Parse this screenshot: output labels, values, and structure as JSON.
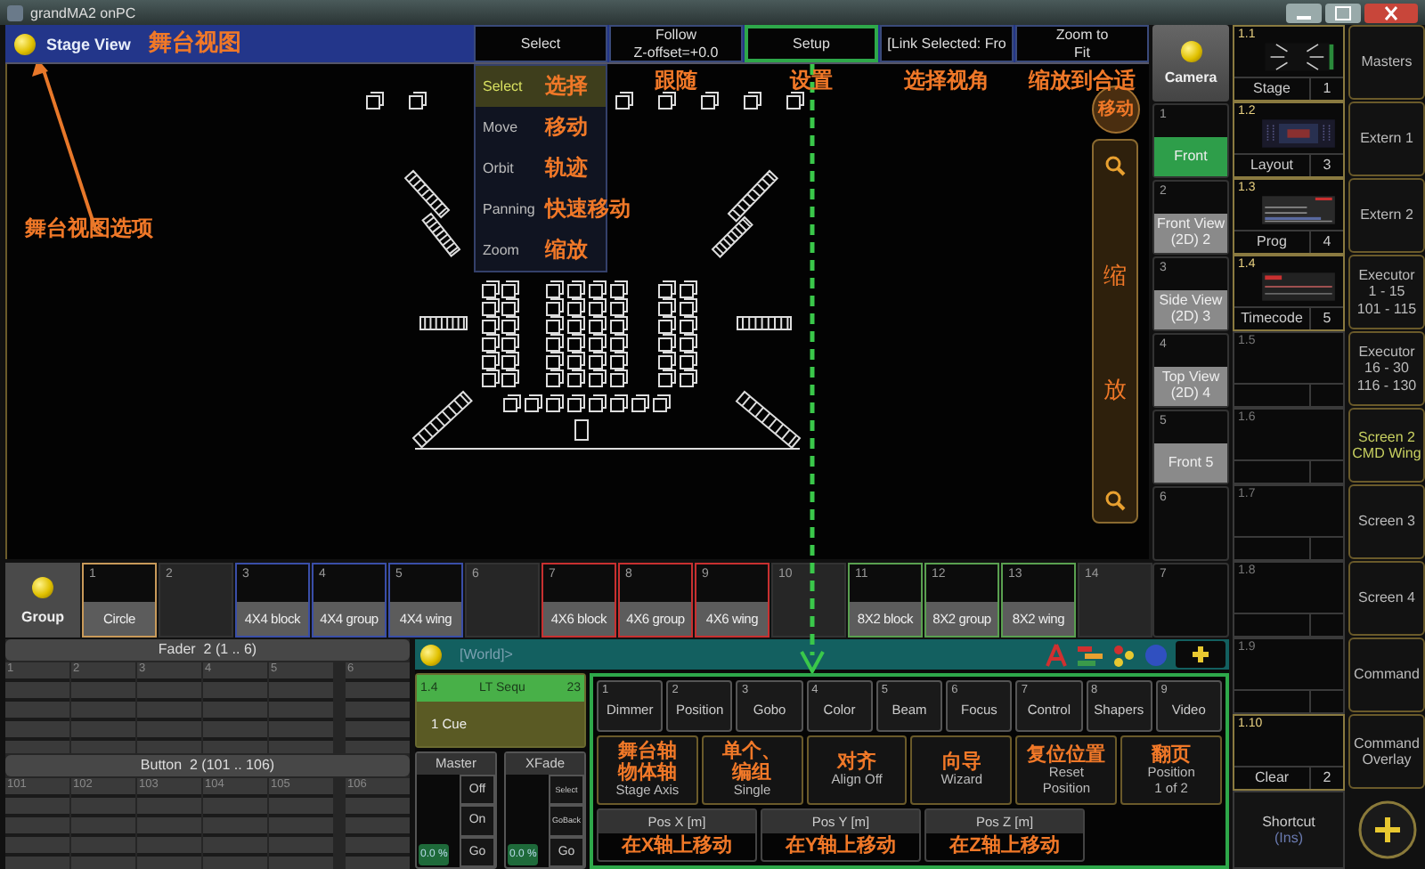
{
  "window": {
    "title": "grandMA2 onPC"
  },
  "stage_view": {
    "title": "Stage View",
    "title_note": "舞台视图",
    "options_note": "舞台视图选项",
    "toolbar": [
      {
        "lines": [
          "Select"
        ],
        "highlighted": false
      },
      {
        "lines": [
          "Follow",
          "Z-offset=+0.0"
        ],
        "highlighted": false,
        "note": "跟随"
      },
      {
        "lines": [
          "Setup"
        ],
        "highlighted": true,
        "note": "设置"
      },
      {
        "lines": [
          "[Link Selected: Fro"
        ],
        "highlighted": false,
        "note": "选择视角"
      },
      {
        "lines": [
          "Zoom to",
          "Fit"
        ],
        "highlighted": false,
        "note": "缩放到合适"
      }
    ],
    "menu": [
      {
        "label": "Select",
        "selected": true,
        "note": "选择"
      },
      {
        "label": "Move",
        "selected": false,
        "note": "移动"
      },
      {
        "label": "Orbit",
        "selected": false,
        "note": "轨迹"
      },
      {
        "label": "Panning",
        "selected": false,
        "note": "快速移动"
      },
      {
        "label": "Zoom",
        "selected": false,
        "note": "缩放"
      }
    ],
    "move_note": "移动",
    "zoom_notes": [
      "缩",
      "放"
    ]
  },
  "camera": {
    "title": "Camera",
    "views": [
      {
        "number": "1",
        "label": "Front",
        "selected": true
      },
      {
        "number": "2",
        "label": "Front View (2D) 2",
        "selected": false
      },
      {
        "number": "3",
        "label": "Side View (2D) 3",
        "selected": false
      },
      {
        "number": "4",
        "label": "Top View (2D) 4",
        "selected": false
      },
      {
        "number": "5",
        "label": "Front 5",
        "selected": false
      },
      {
        "number": "6"
      },
      {
        "number": "7"
      }
    ]
  },
  "views": [
    {
      "number": "1.1",
      "label": "Stage",
      "count": "1",
      "kind": "stage"
    },
    {
      "number": "1.2",
      "label": "Layout",
      "count": "3",
      "kind": "layout"
    },
    {
      "number": "1.3",
      "label": "Prog",
      "count": "4",
      "kind": "prog"
    },
    {
      "number": "1.4",
      "label": "Timecode",
      "count": "5",
      "kind": "timecode"
    },
    {
      "number": "1.5",
      "kind": "empty"
    },
    {
      "number": "1.6",
      "kind": "empty"
    },
    {
      "number": "1.7",
      "kind": "empty"
    },
    {
      "number": "1.8",
      "kind": "empty"
    },
    {
      "number": "1.9",
      "kind": "empty"
    },
    {
      "number": "1.10",
      "label": "Clear",
      "count": "2",
      "kind": "empty"
    },
    {
      "label": "Shortcut",
      "sub": "(Ins)",
      "kind": "shortcut"
    }
  ],
  "screens": [
    {
      "lines": [
        "Masters"
      ],
      "active": false
    },
    {
      "lines": [
        "Extern 1"
      ],
      "active": false
    },
    {
      "lines": [
        "Extern 2"
      ],
      "active": false
    },
    {
      "lines": [
        "Executor",
        "1 - 15",
        "101 - 115"
      ],
      "active": false
    },
    {
      "lines": [
        "Executor",
        "16 - 30",
        "116 - 130"
      ],
      "active": false
    },
    {
      "lines": [
        "Screen 2",
        "CMD Wing"
      ],
      "active": true
    },
    {
      "lines": [
        "Screen 3"
      ],
      "active": false
    },
    {
      "lines": [
        "Screen 4"
      ],
      "active": false
    },
    {
      "lines": [
        "Command"
      ],
      "active": false
    },
    {
      "lines": [
        "Command",
        "Overlay"
      ],
      "active": false
    }
  ],
  "groups": {
    "title": "Group",
    "items": [
      {
        "number": "1",
        "label": "Circle",
        "color": "#c89a5a"
      },
      {
        "number": "2"
      },
      {
        "number": "3",
        "label": "4X4 block",
        "color": "#3a4ea8"
      },
      {
        "number": "4",
        "label": "4X4 group",
        "color": "#3a4ea8"
      },
      {
        "number": "5",
        "label": "4X4 wing",
        "color": "#3a4ea8"
      },
      {
        "number": "6"
      },
      {
        "number": "7",
        "label": "4X6 block",
        "color": "#c83030"
      },
      {
        "number": "8",
        "label": "4X6 group",
        "color": "#c83030"
      },
      {
        "number": "9",
        "label": "4X6 wing",
        "color": "#c83030"
      },
      {
        "number": "10"
      },
      {
        "number": "11",
        "label": "8X2 block",
        "color": "#5aa050"
      },
      {
        "number": "12",
        "label": "8X2 group",
        "color": "#5aa050"
      },
      {
        "number": "13",
        "label": "8X2 wing",
        "color": "#5aa050"
      },
      {
        "number": "14"
      }
    ]
  },
  "faders": {
    "fader_title": "Fader  2 (1 .. 6)",
    "fader_columns": [
      "1",
      "2",
      "3",
      "4",
      "5",
      "6"
    ],
    "button_title": "Button  2 (101 .. 106)",
    "button_columns": [
      "101",
      "102",
      "103",
      "104",
      "105",
      "106"
    ]
  },
  "command": {
    "prompt": "[World]>",
    "sequence": {
      "number": "1.4",
      "name": "LT Sequ",
      "count": "23",
      "cue": "1 Cue"
    },
    "master": {
      "title": "Master",
      "buttons": [
        "Off",
        "On",
        "Go"
      ],
      "value": "0.0 %"
    },
    "xfade": {
      "title": "XFade",
      "buttons": [
        "Select",
        "GoBack",
        "Go"
      ],
      "value": "0.0 %"
    },
    "features": [
      {
        "number": "1",
        "label": "Dimmer"
      },
      {
        "number": "2",
        "label": "Position"
      },
      {
        "number": "3",
        "label": "Gobo"
      },
      {
        "number": "4",
        "label": "Color"
      },
      {
        "number": "5",
        "label": "Beam"
      },
      {
        "number": "6",
        "label": "Focus"
      },
      {
        "number": "7",
        "label": "Control"
      },
      {
        "number": "8",
        "label": "Shapers"
      },
      {
        "number": "9",
        "label": "Video"
      }
    ],
    "encoders": [
      {
        "notes": [
          "舞台轴",
          "物体轴"
        ],
        "lines": [
          "Stage Axis"
        ]
      },
      {
        "notes": [
          "单个、",
          "编组"
        ],
        "lines": [
          "Single"
        ]
      },
      {
        "notes": [
          "对齐"
        ],
        "lines": [
          "Align Off"
        ]
      },
      {
        "notes": [
          "向导"
        ],
        "lines": [
          "Wizard"
        ]
      },
      {
        "notes": [
          "复位位置"
        ],
        "lines": [
          "Reset",
          "Position"
        ]
      },
      {
        "notes": [
          "翻页"
        ],
        "lines": [
          "Position",
          "1 of 2"
        ]
      }
    ],
    "axes": [
      {
        "label": "Pos X [m]",
        "note": "在X轴上移动"
      },
      {
        "label": "Pos Y [m]",
        "note": "在Y轴上移动"
      },
      {
        "label": "Pos Z [m]",
        "note": "在Z轴上移动"
      }
    ]
  }
}
